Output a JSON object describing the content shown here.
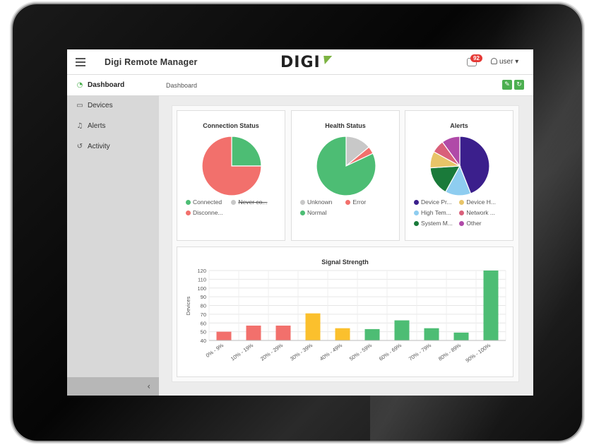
{
  "app": {
    "title": "Digi Remote Manager",
    "logo": "DIGI",
    "notification_count": "92",
    "user_label": "user"
  },
  "sidebar": {
    "items": [
      {
        "label": "Dashboard",
        "icon": "speedometer-icon",
        "active": true
      },
      {
        "label": "Devices",
        "icon": "device-icon",
        "active": false
      },
      {
        "label": "Alerts",
        "icon": "bell-icon",
        "active": false
      },
      {
        "label": "Activity",
        "icon": "history-icon",
        "active": false
      }
    ]
  },
  "breadcrumb": "Dashboard",
  "colors": {
    "accent": "#4caf50",
    "connected": "#4dbd74",
    "never_connected": "#c8c8c8",
    "disconnected": "#f2706c"
  },
  "cards": {
    "connection": {
      "title": "Connection Status",
      "legend": [
        {
          "label": "Connected",
          "color": "#4dbd74",
          "hidden": false
        },
        {
          "label": "Never co...",
          "color": "#c8c8c8",
          "hidden": true
        },
        {
          "label": "Disconne...",
          "color": "#f2706c",
          "hidden": false
        }
      ]
    },
    "health": {
      "title": "Health Status",
      "legend": [
        {
          "label": "Unknown",
          "color": "#c8c8c8"
        },
        {
          "label": "Error",
          "color": "#f2706c"
        },
        {
          "label": "Normal",
          "color": "#4dbd74"
        }
      ]
    },
    "alerts": {
      "title": "Alerts",
      "legend": [
        {
          "label": "Device Pr...",
          "color": "#3b1f8c"
        },
        {
          "label": "Device H...",
          "color": "#e8c468"
        },
        {
          "label": "High Tem...",
          "color": "#8ecdf0"
        },
        {
          "label": "Network ...",
          "color": "#d9607a"
        },
        {
          "label": "System M...",
          "color": "#1a7a3a"
        },
        {
          "label": "Other",
          "color": "#b04aa8"
        }
      ]
    }
  },
  "chart_data": [
    {
      "type": "pie",
      "title": "Connection Status",
      "labels": [
        "Connected",
        "Disconne..."
      ],
      "values": [
        25,
        75
      ],
      "colors": [
        "#4dbd74",
        "#f2706c"
      ]
    },
    {
      "type": "pie",
      "title": "Health Status",
      "labels": [
        "Unknown",
        "Error",
        "Normal"
      ],
      "values": [
        14,
        4,
        82
      ],
      "colors": [
        "#c8c8c8",
        "#f2706c",
        "#4dbd74"
      ]
    },
    {
      "type": "pie",
      "title": "Alerts",
      "labels": [
        "Device Pr...",
        "High Tem...",
        "System M...",
        "Device H...",
        "Network ...",
        "Other"
      ],
      "values": [
        44,
        14,
        16,
        9,
        7,
        10
      ],
      "colors": [
        "#3b1f8c",
        "#8ecdf0",
        "#1a7a3a",
        "#e8c468",
        "#d9607a",
        "#b04aa8"
      ]
    },
    {
      "type": "bar",
      "title": "Signal Strength",
      "xlabel": "",
      "ylabel": "Devices",
      "categories": [
        "0% - 9%",
        "10% - 19%",
        "20% - 29%",
        "30% - 39%",
        "40% - 49%",
        "50% - 59%",
        "60% - 69%",
        "70% - 79%",
        "80% - 89%",
        "90% - 100%"
      ],
      "values": [
        50,
        57,
        57,
        71,
        54,
        53,
        63,
        54,
        49,
        120
      ],
      "colors": [
        "#f2706c",
        "#f2706c",
        "#f2706c",
        "#fbc02d",
        "#fbc02d",
        "#4dbd74",
        "#4dbd74",
        "#4dbd74",
        "#4dbd74",
        "#4dbd74"
      ],
      "ylim": [
        40,
        120
      ],
      "yticks": [
        40,
        50,
        60,
        70,
        80,
        90,
        100,
        110,
        120
      ],
      "grid": true
    }
  ]
}
